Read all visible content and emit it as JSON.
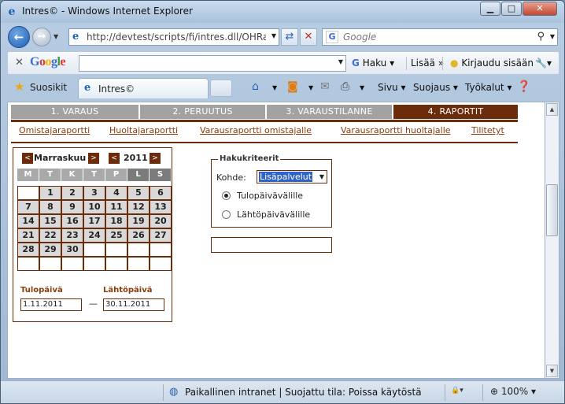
{
  "window": {
    "title": "Intres© - Windows Internet Explorer"
  },
  "address": {
    "url": "http://devtest/scripts/fi/intres.dll/OHRap_",
    "search_placeholder": "Google"
  },
  "google_bar": {
    "logo": "Google",
    "search_label": "Haku",
    "more_label": "Lisää",
    "signin_label": "Kirjaudu sisään"
  },
  "favorites_bar": {
    "favorites_label": "Suosikit",
    "tab_title": "Intres©",
    "commands": {
      "page": "Sivu",
      "safety": "Suojaus",
      "tools": "Työkalut"
    }
  },
  "tabs": [
    {
      "label": "1. VARAUS"
    },
    {
      "label": "2. PERUUTUS"
    },
    {
      "label": "3. VARAUSTILANNE"
    },
    {
      "label": "4. RAPORTIT",
      "active": true
    }
  ],
  "subnav": [
    {
      "label": "Omistajaraportti"
    },
    {
      "label": "Huoltajaraportti"
    },
    {
      "label": "Varausraportti omistajalle"
    },
    {
      "label": "Varausraportti huoltajalle"
    },
    {
      "label": "Tilitetyt"
    }
  ],
  "calendar": {
    "prev_month": "<",
    "next_month": ">",
    "month": "Marraskuu",
    "year": "2011",
    "weekdays": [
      "M",
      "T",
      "K",
      "T",
      "P",
      "L",
      "S"
    ],
    "weeks": [
      [
        "",
        "1",
        "2",
        "3",
        "4",
        "5",
        "6"
      ],
      [
        "7",
        "8",
        "9",
        "10",
        "11",
        "12",
        "13"
      ],
      [
        "14",
        "15",
        "16",
        "17",
        "18",
        "19",
        "20"
      ],
      [
        "21",
        "22",
        "23",
        "24",
        "25",
        "26",
        "27"
      ],
      [
        "28",
        "29",
        "30",
        "",
        "",
        "",
        ""
      ],
      [
        "",
        "",
        "",
        "",
        "",
        "",
        ""
      ]
    ],
    "arrival_label": "Tulopäivä",
    "departure_label": "Lähtöpäivä",
    "arrival_value": "1.11.2011",
    "departure_value": "30.11.2011",
    "range_separator": "—"
  },
  "criteria": {
    "legend": "Hakukriteerit",
    "target_label": "Kohde:",
    "target_value": "Lisäpalvelut",
    "options": [
      {
        "label": "Tulopäivävälille",
        "checked": true
      },
      {
        "label": "Lähtöpäivävälille",
        "checked": false
      }
    ]
  },
  "status": {
    "zone_text": "Paikallinen intranet | Suojattu tila: Poissa käytöstä",
    "zoom": "100%"
  },
  "icons": {
    "ie": "ie-logo-icon",
    "back": "back-arrow-icon",
    "forward": "forward-arrow-icon",
    "refresh": "refresh-icon",
    "stop": "stop-icon",
    "search": "search-icon",
    "star": "favorites-star-icon",
    "home": "home-icon",
    "rss": "rss-icon",
    "mail": "mail-icon",
    "print": "print-icon",
    "help": "help-icon",
    "wrench": "wrench-icon",
    "globe": "intranet-globe-icon"
  },
  "colors": {
    "accent": "#6b2c0c",
    "tab_inactive": "#a2a2a2",
    "selection": "#2f63c8"
  }
}
